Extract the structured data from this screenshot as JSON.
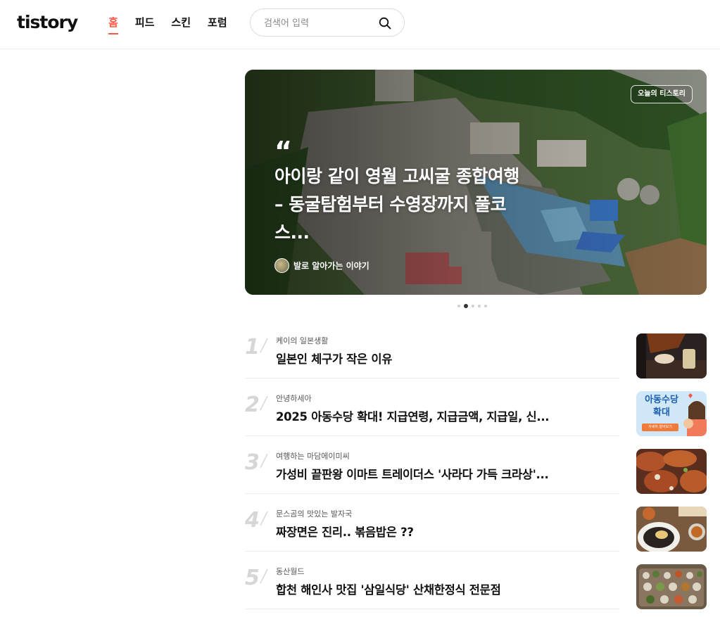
{
  "header": {
    "logo": "tistory",
    "nav": [
      {
        "label": "홈",
        "active": true
      },
      {
        "label": "피드",
        "active": false
      },
      {
        "label": "스킨",
        "active": false
      },
      {
        "label": "포럼",
        "active": false
      }
    ],
    "search": {
      "placeholder": "검색어 입력"
    }
  },
  "hero": {
    "badge": "오늘의 티스토리",
    "quote": "“",
    "title": "아이랑 같이 영월 고씨굴 종합여행 – 동굴탐험부터 수영장까지 풀코스...",
    "author": "발로 알아가는 이야기"
  },
  "carousel": {
    "count": 5,
    "active_index": 1
  },
  "ranking": [
    {
      "rank": "1",
      "blog": "케이의 일본생활",
      "title": "일본인 체구가 작은 이유"
    },
    {
      "rank": "2",
      "blog": "안녕하세아",
      "title": "2025 아동수당 확대! 지급연령, 지급금액, 지급일, 신...",
      "thumb_text": "아동수당 확대",
      "thumb_button": "자세히 알아보기"
    },
    {
      "rank": "3",
      "blog": "여행하는 마담에이미씨",
      "title": "가성비 끝판왕 이마트 트레이더스 '사라다 가득 크라상'..."
    },
    {
      "rank": "4",
      "blog": "문스곰의 맛있는 발자국",
      "title": "짜장면은 진리.. 볶음밥은 ??"
    },
    {
      "rank": "5",
      "blog": "동산월드",
      "title": "합천 해인사 맛집 '삼일식당' 산채한정식 전문점"
    }
  ],
  "colors": {
    "accent": "#ff5544",
    "rank_number": "#d6d6d6",
    "separator": "#ececec"
  }
}
